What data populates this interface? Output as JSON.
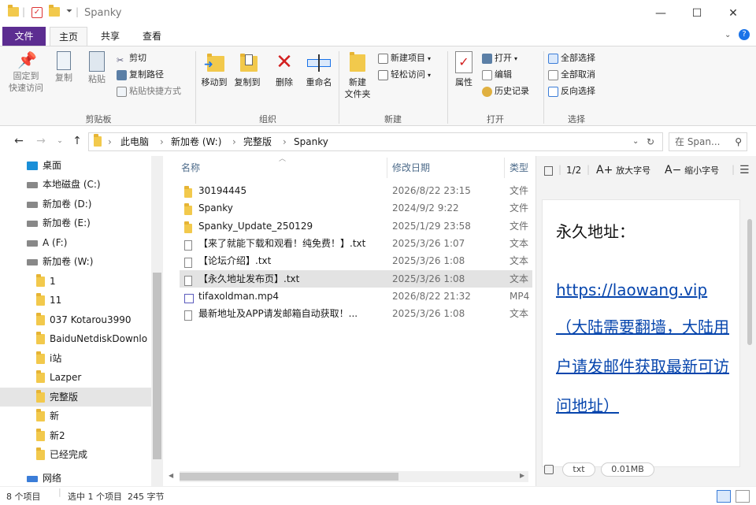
{
  "window": {
    "title": "Spanky",
    "minimize": "—",
    "maximize": "☐",
    "close": "✕"
  },
  "ribbon_tabs": [
    "文件",
    "主页",
    "共享",
    "查看"
  ],
  "ribbon": {
    "clipboard": {
      "pin": "固定到\n快速访问",
      "copy": "复制",
      "paste": "粘贴",
      "cut": "剪切",
      "copy_path": "复制路径",
      "paste_shortcut": "粘贴快捷方式",
      "group": "剪贴板"
    },
    "organize": {
      "move_to": "移动到",
      "copy_to": "复制到",
      "delete": "删除",
      "rename": "重命名",
      "group": "组织"
    },
    "new": {
      "new_folder": "新建\n文件夹",
      "new_item": "新建项目",
      "easy_access": "轻松访问",
      "group": "新建"
    },
    "open": {
      "properties": "属性",
      "open": "打开",
      "edit": "编辑",
      "history": "历史记录",
      "group": "打开"
    },
    "select": {
      "select_all": "全部选择",
      "select_none": "全部取消",
      "invert": "反向选择",
      "group": "选择"
    }
  },
  "address": {
    "crumbs": [
      "此电脑",
      "新加卷 (W:)",
      "完整版",
      "Spanky"
    ],
    "search_placeholder": "在 Span..."
  },
  "nav_pane": [
    {
      "label": "桌面",
      "kind": "desktop",
      "indent": 0
    },
    {
      "label": "本地磁盘 (C:)",
      "kind": "drive",
      "indent": 0
    },
    {
      "label": "新加卷 (D:)",
      "kind": "drive",
      "indent": 0
    },
    {
      "label": "新加卷 (E:)",
      "kind": "drive",
      "indent": 0
    },
    {
      "label": "A (F:)",
      "kind": "drive",
      "indent": 0
    },
    {
      "label": "新加卷 (W:)",
      "kind": "drive",
      "indent": 0
    },
    {
      "label": "1",
      "kind": "folder",
      "indent": 1
    },
    {
      "label": "11",
      "kind": "folder",
      "indent": 1
    },
    {
      "label": "037 Kotarou3990",
      "kind": "folder",
      "indent": 1
    },
    {
      "label": "BaiduNetdiskDownlo",
      "kind": "folder",
      "indent": 1
    },
    {
      "label": "i站",
      "kind": "folder",
      "indent": 1
    },
    {
      "label": "Lazper",
      "kind": "folder",
      "indent": 1
    },
    {
      "label": "完整版",
      "kind": "folder",
      "indent": 1,
      "selected": true
    },
    {
      "label": "新",
      "kind": "folder",
      "indent": 1
    },
    {
      "label": "新2",
      "kind": "folder",
      "indent": 1
    },
    {
      "label": "已经完成",
      "kind": "folder",
      "indent": 1
    },
    {
      "label": "网络",
      "kind": "network",
      "indent": 0
    }
  ],
  "file_list": {
    "headers": [
      "名称",
      "修改日期",
      "类型"
    ],
    "rows": [
      {
        "name": "30194445",
        "date": "2026/8/22 23:15",
        "type": "文件",
        "icon": "folder"
      },
      {
        "name": "Spanky",
        "date": "2024/9/2 9:22",
        "type": "文件",
        "icon": "folder"
      },
      {
        "name": "Spanky_Update_250129",
        "date": "2025/1/29 23:58",
        "type": "文件",
        "icon": "folder"
      },
      {
        "name": "【来了就能下载和观看！纯免费！】.txt",
        "date": "2025/3/26 1:07",
        "type": "文本",
        "icon": "txt"
      },
      {
        "name": "【论坛介绍】.txt",
        "date": "2025/3/26 1:08",
        "type": "文本",
        "icon": "txt"
      },
      {
        "name": "【永久地址发布页】.txt",
        "date": "2025/3/26 1:08",
        "type": "文本",
        "icon": "txt",
        "selected": true
      },
      {
        "name": "tifaxoldman.mp4",
        "date": "2026/8/22 21:32",
        "type": "MP4",
        "icon": "video"
      },
      {
        "name": "最新地址及APP请发邮箱自动获取！...",
        "date": "2025/3/26 1:08",
        "type": "文本",
        "icon": "txt"
      }
    ]
  },
  "preview": {
    "page": "1/2",
    "zoom_in": "放大字号",
    "zoom_out": "缩小字号",
    "heading": "永久地址：",
    "link": "https://laowang.vip",
    "note": "（大陆需要翻墙，大陆用户请发邮件获取最新可访问地址）",
    "ext_chip": "txt",
    "size_chip": "0.01MB"
  },
  "status": {
    "count": "8 个项目",
    "selection": "选中 1 个项目  245 字节"
  },
  "colors": {
    "file_tab": "#5c2d91",
    "accent": "#1a73e8",
    "link": "#0645ad",
    "selection": "#e3e3e3",
    "folder": "#f2c94c"
  }
}
